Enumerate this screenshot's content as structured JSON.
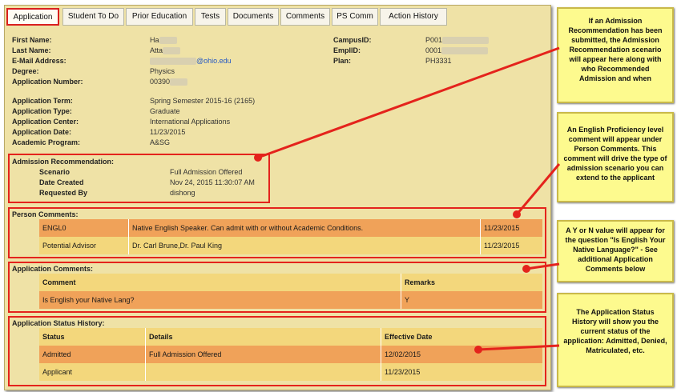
{
  "tabs": [
    "Application",
    "Student To Do",
    "Prior Education",
    "Tests",
    "Documents",
    "Comments",
    "PS Comm",
    "Action History"
  ],
  "applicant": {
    "first_name_label": "First Name:",
    "first_name": "Ha",
    "last_name_label": "Last Name:",
    "last_name": "Atta",
    "email_label": "E-Mail Address:",
    "email_domain": "@ohio.edu",
    "degree_label": "Degree:",
    "degree": "Physics",
    "app_number_label": "Application Number:",
    "app_number": "00390",
    "campus_id_label": "CampusID:",
    "campus_id": "P001",
    "empl_id_label": "EmplID:",
    "empl_id": "0001",
    "plan_label": "Plan:",
    "plan": "PH3331",
    "term_label": "Application Term:",
    "term": "Spring Semester 2015-16 (2165)",
    "type_label": "Application Type:",
    "type": "Graduate",
    "center_label": "Application Center:",
    "center": "International Applications",
    "date_label": "Application Date:",
    "date": "11/23/2015",
    "program_label": "Academic Program:",
    "program": "A&SG"
  },
  "recommendation": {
    "title": "Admission Recommendation:",
    "scenario_label": "Scenario",
    "scenario": "Full Admission Offered",
    "created_label": "Date Created",
    "created": "Nov 24, 2015 11:30:07 AM",
    "requested_label": "Requested By",
    "requested": "dishong"
  },
  "person_comments": {
    "title": "Person Comments:",
    "rows": [
      {
        "code": "ENGL0",
        "text": "Native English Speaker. Can admit with or without Academic Conditions.",
        "date": "11/23/2015"
      },
      {
        "code": "Potential Advisor",
        "text": "Dr. Carl Brune,Dr. Paul King",
        "date": "11/23/2015"
      }
    ]
  },
  "application_comments": {
    "title": "Application Comments:",
    "col_comment": "Comment",
    "col_remarks": "Remarks",
    "rows": [
      {
        "comment": "Is English your Native Lang?",
        "remarks": "Y"
      }
    ]
  },
  "status_history": {
    "title": "Application Status History:",
    "col_status": "Status",
    "col_details": "Details",
    "col_date": "Effective Date",
    "rows": [
      {
        "status": "Admitted",
        "details": "Full Admission Offered",
        "date": "12/02/2015"
      },
      {
        "status": "Applicant",
        "details": "",
        "date": "11/23/2015"
      }
    ]
  },
  "notes": [
    "If an Admission Recommendation has been submitted, the Admission Recommendation scenario will appear here along with who Recommended Admission and when",
    "An English Proficiency level comment will appear under Person Comments. This comment will drive the type of admission scenario you can extend to the applicant",
    "A Y or N value will appear for the question \"Is English Your Native Language?\" - See additional Application Comments below",
    "The Application Status History will show you the current status of the application: Admitted, Denied, Matriculated, etc."
  ],
  "colors": {
    "panel": "#efe2a6",
    "orange_row": "#f0a259",
    "yellow_row": "#f3d77c",
    "highlight_red": "#e4231c",
    "note_bg": "#fdfa8e"
  }
}
